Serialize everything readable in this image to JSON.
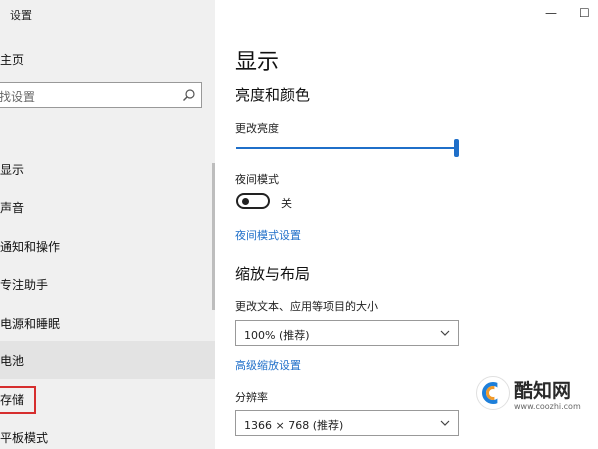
{
  "sidebar": {
    "app_title": "设置",
    "home": "主页",
    "search_placeholder": "找设置",
    "items": [
      {
        "label": "显示"
      },
      {
        "label": "声音"
      },
      {
        "label": "通知和操作"
      },
      {
        "label": "专注助手"
      },
      {
        "label": "电源和睡眠"
      },
      {
        "label": "电池"
      },
      {
        "label": "存储"
      },
      {
        "label": "平板模式"
      }
    ]
  },
  "window": {
    "minimize": "—",
    "maximize": "☐"
  },
  "main": {
    "title": "显示",
    "brightness_section": "亮度和颜色",
    "brightness_label": "更改亮度",
    "brightness_level": 1.0,
    "night_mode_label": "夜间模式",
    "night_mode_state": "关",
    "night_mode_link": "夜间模式设置",
    "scale_section": "缩放与布局",
    "scale_label": "更改文本、应用等项目的大小",
    "scale_value": "100% (推荐)",
    "advanced_scale_link": "高级缩放设置",
    "resolution_label": "分辨率",
    "resolution_value": "1366 × 768 (推荐)"
  },
  "watermark": {
    "name": "酷知网",
    "url": "www.coozhi.com"
  },
  "colors": {
    "accent": "#1f6fc9",
    "highlight_box": "#d62e2e"
  }
}
